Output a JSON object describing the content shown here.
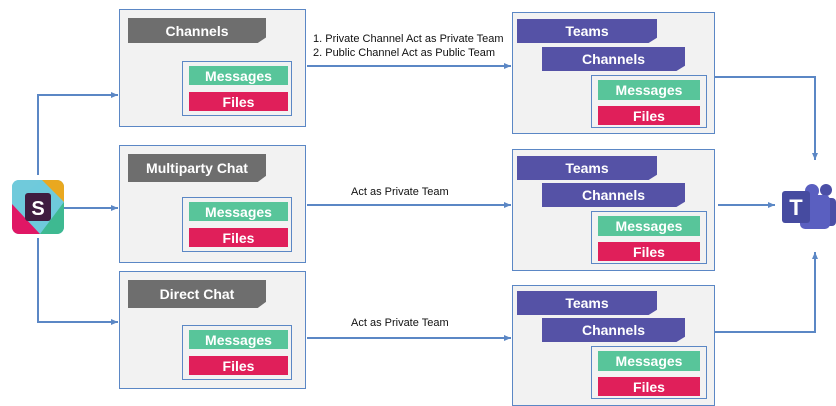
{
  "colors": {
    "line": "#5b87c5",
    "panel_bg": "#f2f2f2",
    "header_gray": "#6e6e6e",
    "header_purple": "#5552a6",
    "messages": "#58c59a",
    "files": "#e01f5a",
    "teams_brand": "#4b4fa6"
  },
  "icons": {
    "slack": "slack-logo-icon",
    "teams": "microsoft-teams-logo-icon"
  },
  "slack_logo_letter": "S",
  "teams_logo_letter": "T",
  "sources": [
    {
      "title": "Channels",
      "messages": "Messages",
      "files": "Files"
    },
    {
      "title": "Multiparty Chat",
      "messages": "Messages",
      "files": "Files"
    },
    {
      "title": "Direct Chat",
      "messages": "Messages",
      "files": "Files"
    }
  ],
  "mappings": [
    {
      "line1": "1. Private Channel Act as Private Team",
      "line2": "2. Public Channel Act as Public Team"
    },
    {
      "line1": "Act as Private Team",
      "line2": ""
    },
    {
      "line1": "Act as Private Team",
      "line2": ""
    }
  ],
  "targets": [
    {
      "teams": "Teams",
      "channels": "Channels",
      "messages": "Messages",
      "files": "Files"
    },
    {
      "teams": "Teams",
      "channels": "Channels",
      "messages": "Messages",
      "files": "Files"
    },
    {
      "teams": "Teams",
      "channels": "Channels",
      "messages": "Messages",
      "files": "Files"
    }
  ]
}
